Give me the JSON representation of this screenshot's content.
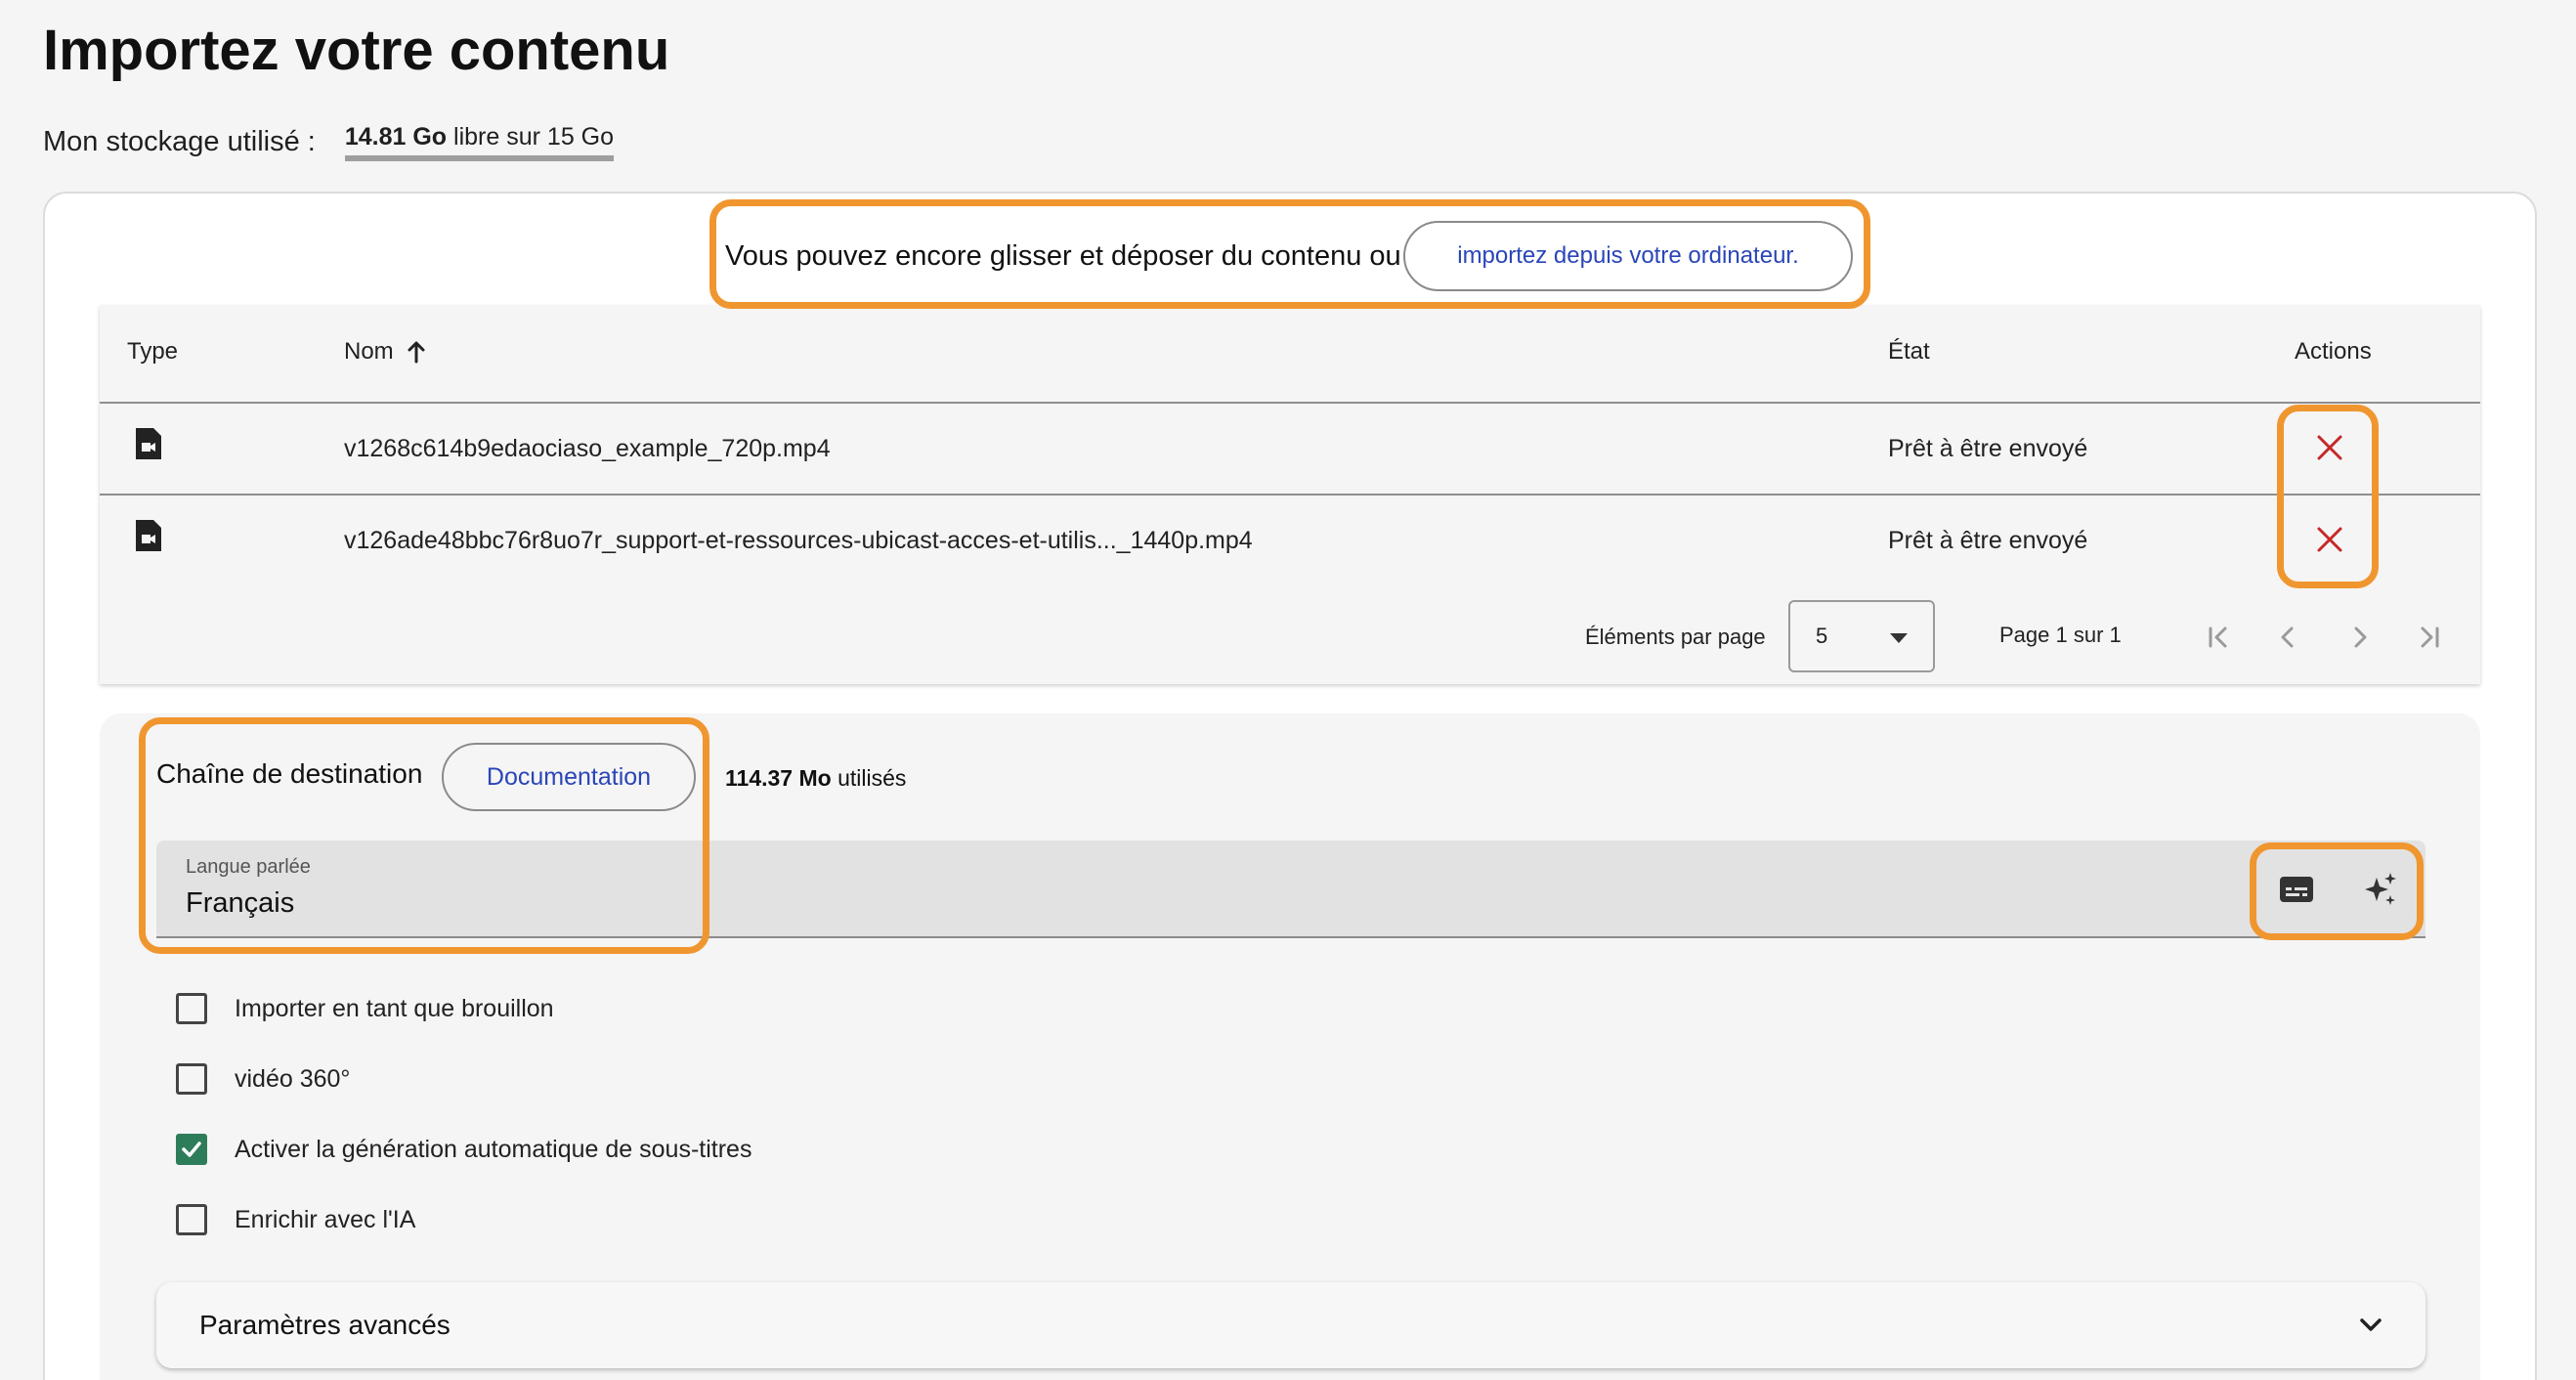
{
  "page": {
    "title": "Importez votre contenu"
  },
  "storage": {
    "label": "Mon stockage utilisé :",
    "free": "14.81 Go",
    "rest": "libre sur 15 Go"
  },
  "dropzone": {
    "text": "Vous pouvez encore glisser et déposer du contenu ou",
    "import_button": "importez depuis votre ordinateur."
  },
  "table": {
    "columns": {
      "type": "Type",
      "name": "Nom",
      "status": "État",
      "actions": "Actions"
    },
    "sort_icon": "arrow-up-icon",
    "rows": [
      {
        "icon": "video-file-icon",
        "name": "v1268c614b9edaociaso_example_720p.mp4",
        "status": "Prêt à être envoyé",
        "action_icon": "close-icon"
      },
      {
        "icon": "video-file-icon",
        "name": "v126ade48bbc76r8uo7r_support-et-ressources-ubicast-acces-et-utilis..._1440p.mp4",
        "status": "Prêt à être envoyé",
        "action_icon": "close-icon"
      }
    ],
    "pagination": {
      "items_per_page_label": "Éléments par page",
      "items_per_page_value": "5",
      "page_info": "Page 1 sur 1"
    }
  },
  "settings": {
    "channel_label": "Chaîne de destination",
    "documentation_button": "Documentation",
    "usage_value": "114.37 Mo",
    "usage_suffix": "utilisés",
    "language": {
      "label": "Langue parlée",
      "value": "Français"
    },
    "options": [
      {
        "label": "Importer en tant que brouillon",
        "checked": false
      },
      {
        "label": "vidéo 360°",
        "checked": false
      },
      {
        "label": "Activer la génération automatique de sous-titres",
        "checked": true
      },
      {
        "label": "Enrichir avec l'IA",
        "checked": false
      }
    ],
    "advanced_label": "Paramètres avancés"
  },
  "colors": {
    "highlight": "#f0962f",
    "link": "#2a45b8",
    "delete": "#c62828",
    "checkbox_checked": "#2e7d5a"
  }
}
